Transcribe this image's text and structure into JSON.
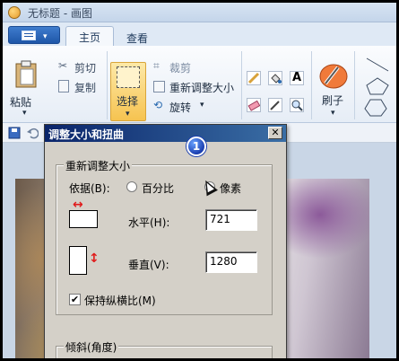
{
  "window": {
    "title": "无标题 - 画图"
  },
  "tabs": [
    {
      "label": "主页",
      "active": true
    },
    {
      "label": "查看",
      "active": false
    }
  ],
  "ribbon": {
    "paste_label": "粘贴",
    "cut_label": "剪切",
    "copy_label": "复制",
    "select_label": "选择",
    "crop_label": "裁剪",
    "resize_label": "重新调整大小",
    "rotate_label": "旋转",
    "brush_label": "刷子",
    "dropdown_glyph": "▾"
  },
  "dialog": {
    "title": "调整大小和扭曲",
    "close_glyph": "✕",
    "step_badge": "1",
    "resize_group": {
      "legend": "重新调整大小",
      "by_label": "依据(B):",
      "percent_label": "百分比",
      "pixels_label": "像素",
      "selected": "pixels",
      "horizontal_label": "水平(H):",
      "horizontal_value": "721",
      "vertical_label": "垂直(V):",
      "vertical_value": "1280",
      "keep_ratio_label": "保持纵横比(M)",
      "keep_ratio_checked": true,
      "check_glyph": "✔",
      "horizontal_arrow_glyph": "↔",
      "vertical_arrow_glyph": "↕"
    },
    "skew_group": {
      "legend": "倾斜(角度)"
    }
  },
  "colors": {
    "accent": "#1e56a8",
    "dialog_title": "#0a246a",
    "dialog_bg": "#d4d0c8",
    "select_highlight": "#f6c350",
    "arrow_red": "#e01b1b"
  },
  "icons": [
    "paint-app-icon",
    "save-icon",
    "undo-icon",
    "redo-icon",
    "file-menu-icon",
    "paste-icon",
    "cut-icon",
    "copy-icon",
    "select-icon",
    "crop-icon",
    "resize-icon",
    "rotate-icon",
    "pencil-icon",
    "fill-icon",
    "text-icon",
    "eraser-icon",
    "color-picker-icon",
    "magnifier-icon",
    "brush-icon",
    "shapes-icon",
    "close-icon",
    "horizontal-resize-icon",
    "vertical-resize-icon",
    "mouse-cursor-icon"
  ]
}
